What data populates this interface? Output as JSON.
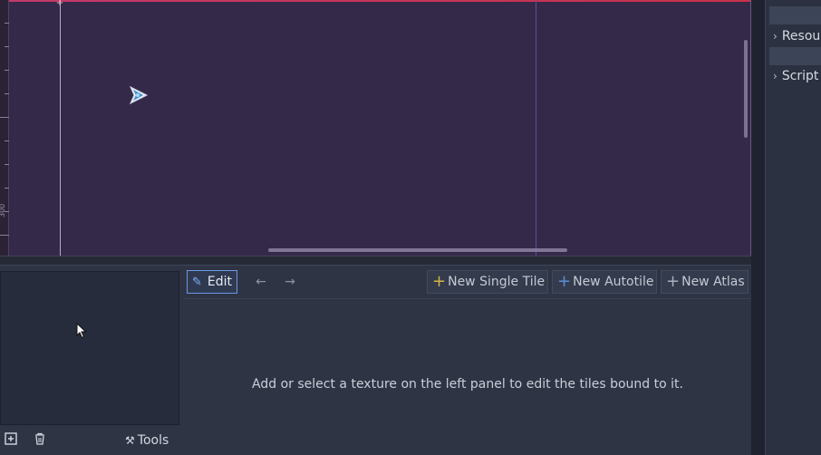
{
  "viewport": {
    "ruler_label": "300",
    "origin_marker": "+"
  },
  "tileset_panel": {
    "toolbar": {
      "edit_label": "Edit",
      "prev_label": "←",
      "next_label": "→",
      "new_single_tile_label": "New Single Tile",
      "new_autotile_label": "New Autotile",
      "new_atlas_label": "New Atlas"
    },
    "hint_text": "Add or select a texture on the left panel to edit the tiles bound to it.",
    "left_tools": {
      "add_icon": "add-icon",
      "remove_icon": "trash-icon",
      "tools_label": "Tools"
    }
  },
  "inspector": {
    "items": [
      {
        "label": "Resource"
      },
      {
        "label": "Script"
      }
    ]
  },
  "colors": {
    "viewport_bg": "#35294a",
    "accent_blue": "#6a97e3",
    "single_tile_plus": "#d6b24a",
    "autotile_plus": "#5b8fd9"
  }
}
